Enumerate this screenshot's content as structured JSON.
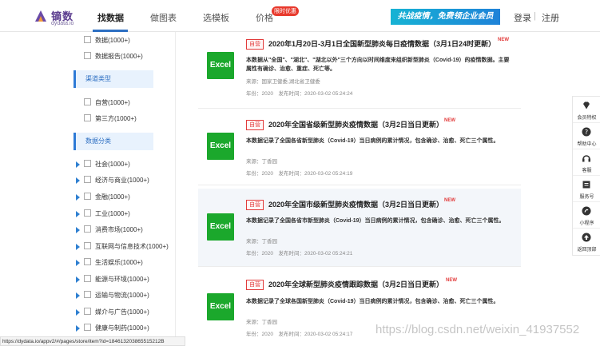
{
  "header": {
    "logo_name": "镝数",
    "logo_sub": "dydata.io",
    "tabs": [
      "找数据",
      "做图表",
      "选模板",
      "价格"
    ],
    "price_badge": "限时优惠",
    "promo": "共战疫情，免费领企业会员",
    "login": "登录",
    "separator": "|",
    "register": "注册",
    "colors": {
      "accent": "#2d6fc2",
      "promo_start": "#17b3d4",
      "promo_end": "#1e82d8"
    }
  },
  "sidebar": {
    "top_items": [
      "数据(1000+)",
      "数据报告(1000+)"
    ],
    "channel_head": "渠道类型",
    "channel_items": [
      "自营(1000+)",
      "第三方(1000+)"
    ],
    "category_head": "数据分类",
    "category_items": [
      "社会(1000+)",
      "经济与商业(1000+)",
      "金融(1000+)",
      "工业(1000+)",
      "消费市场(1000+)",
      "互联网与信息技术(1000+)",
      "生活娱乐(1000+)",
      "能源与环境(1000+)",
      "运输与物流(1000+)",
      "媒介与广告(1000+)",
      "健康与制药(1000+)"
    ]
  },
  "cards": [
    {
      "icon": "Excel",
      "tag": "自营",
      "title": "2020年1月20日-3月1日全国新型肺炎每日疫情数据（3月1日24时更新）",
      "new": "NEW",
      "desc": "本数据从\"全国\"、\"湖北\"、\"湖北以外\"三个方向以时间维度来组织新型肺炎（Covid-19）的疫情数据。主要属性有确诊、治愈、重症、死亡等。",
      "source": "来源：国家卫健委,湖北省卫健委",
      "meta": "年份：2020　发布时间：2020-03-02 05:24:24"
    },
    {
      "icon": "Excel",
      "tag": "自营",
      "title": "2020年全国省级新型肺炎疫情数据（3月2日当日更新）",
      "new": "NEW",
      "desc": "本数据记录了全国各省新型肺炎（Covid-19）当日病例的累计情况，包含确诊、治愈、死亡三个属性。",
      "source": "来源：丁香园",
      "meta": "年份：2020　发布时间：2020-03-02 05:24:19"
    },
    {
      "icon": "Excel",
      "tag": "自营",
      "title": "2020年全国市级新型肺炎疫情数据（3月2日当日更新）",
      "new": "NEW",
      "desc": "本数据记录了全国各省市新型肺炎（Covid-19）当日病例的累计情况，包含确诊、治愈、死亡三个属性。",
      "source": "来源：丁香园",
      "meta": "年份：2020　发布时间：2020-03-02 05:24:21"
    },
    {
      "icon": "Excel",
      "tag": "自营",
      "title": "2020年全球新型肺炎疫情跟踪数据（3月2日当日更新）",
      "new": "NEW",
      "desc": "本数据记录了全球各国新型肺炎（Covid-19）当日病例的累计情况，包含确诊、治愈、死亡三个属性。",
      "source": "来源：丁香园",
      "meta": "年份：2020　发布时间：2020-03-02 05:24:17"
    }
  ],
  "right_float": [
    "会员特权",
    "帮助中心",
    "客服",
    "服务号",
    "小程序",
    "返回顶部"
  ],
  "status_url": "https://dydata.io/appv2/#/pages/store/item?id=184613203865515212B",
  "watermark": "https://blog.csdn.net/weixin_41937552"
}
